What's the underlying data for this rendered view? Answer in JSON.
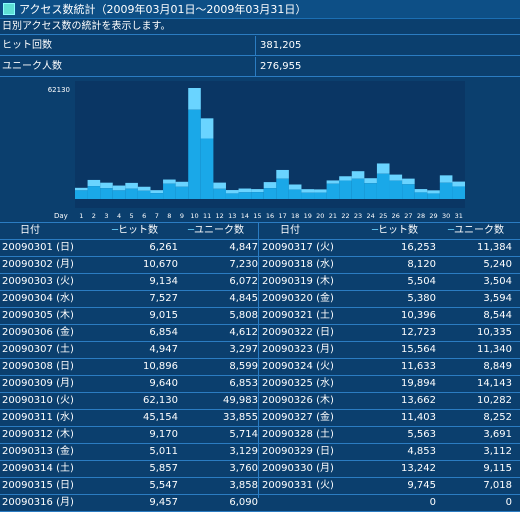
{
  "title": "アクセス数統計（2009年03月01日～2009年03月31日）",
  "description": "日別アクセス数の統計を表示します。",
  "stats": [
    {
      "label": "ヒット回数",
      "value": "381,205"
    },
    {
      "label": "ユニーク人数",
      "value": "276,955"
    }
  ],
  "colors": {
    "hit": "#1aa8e8",
    "unique": "#0a7fd0",
    "hit_light": "#6ad4ff",
    "plot_bg": "#0a3664"
  },
  "chart_data": {
    "type": "bar",
    "ymax_label": "62130",
    "xlabel": "Day",
    "categories": [
      "1",
      "2",
      "3",
      "4",
      "5",
      "6",
      "7",
      "8",
      "9",
      "10",
      "11",
      "12",
      "13",
      "14",
      "15",
      "16",
      "17",
      "18",
      "19",
      "20",
      "21",
      "22",
      "23",
      "24",
      "25",
      "26",
      "27",
      "28",
      "29",
      "30",
      "31"
    ],
    "series": [
      {
        "name": "ヒット数",
        "values": [
          6261,
          10670,
          9134,
          7527,
          9015,
          6854,
          4947,
          10896,
          9640,
          62130,
          45154,
          9170,
          5011,
          5857,
          5547,
          9457,
          16253,
          8120,
          5504,
          5380,
          10396,
          12723,
          15564,
          11633,
          19894,
          13662,
          11403,
          5563,
          4853,
          13242,
          9745
        ]
      },
      {
        "name": "ユニーク数",
        "values": [
          4847,
          7230,
          6072,
          4845,
          5808,
          4612,
          3297,
          8599,
          6853,
          49983,
          33855,
          5714,
          3129,
          3760,
          3858,
          6090,
          11384,
          5240,
          3504,
          3594,
          8544,
          10335,
          11340,
          8849,
          14143,
          10282,
          8252,
          3691,
          3112,
          9115,
          7018
        ]
      }
    ]
  },
  "table_headers": {
    "date": "日付",
    "hits": "ヒット数",
    "unique": "ユニーク数"
  },
  "left_rows": [
    {
      "date": "20090301 (日)",
      "hits": "6,261",
      "unique": "4,847"
    },
    {
      "date": "20090302 (月)",
      "hits": "10,670",
      "unique": "7,230"
    },
    {
      "date": "20090303 (火)",
      "hits": "9,134",
      "unique": "6,072"
    },
    {
      "date": "20090304 (水)",
      "hits": "7,527",
      "unique": "4,845"
    },
    {
      "date": "20090305 (木)",
      "hits": "9,015",
      "unique": "5,808"
    },
    {
      "date": "20090306 (金)",
      "hits": "6,854",
      "unique": "4,612"
    },
    {
      "date": "20090307 (土)",
      "hits": "4,947",
      "unique": "3,297"
    },
    {
      "date": "20090308 (日)",
      "hits": "10,896",
      "unique": "8,599"
    },
    {
      "date": "20090309 (月)",
      "hits": "9,640",
      "unique": "6,853"
    },
    {
      "date": "20090310 (火)",
      "hits": "62,130",
      "unique": "49,983"
    },
    {
      "date": "20090311 (水)",
      "hits": "45,154",
      "unique": "33,855"
    },
    {
      "date": "20090312 (木)",
      "hits": "9,170",
      "unique": "5,714"
    },
    {
      "date": "20090313 (金)",
      "hits": "5,011",
      "unique": "3,129"
    },
    {
      "date": "20090314 (土)",
      "hits": "5,857",
      "unique": "3,760"
    },
    {
      "date": "20090315 (日)",
      "hits": "5,547",
      "unique": "3,858"
    },
    {
      "date": "20090316 (月)",
      "hits": "9,457",
      "unique": "6,090"
    }
  ],
  "right_rows": [
    {
      "date": "20090317 (火)",
      "hits": "16,253",
      "unique": "11,384"
    },
    {
      "date": "20090318 (水)",
      "hits": "8,120",
      "unique": "5,240"
    },
    {
      "date": "20090319 (木)",
      "hits": "5,504",
      "unique": "3,504"
    },
    {
      "date": "20090320 (金)",
      "hits": "5,380",
      "unique": "3,594"
    },
    {
      "date": "20090321 (土)",
      "hits": "10,396",
      "unique": "8,544"
    },
    {
      "date": "20090322 (日)",
      "hits": "12,723",
      "unique": "10,335"
    },
    {
      "date": "20090323 (月)",
      "hits": "15,564",
      "unique": "11,340"
    },
    {
      "date": "20090324 (火)",
      "hits": "11,633",
      "unique": "8,849"
    },
    {
      "date": "20090325 (水)",
      "hits": "19,894",
      "unique": "14,143"
    },
    {
      "date": "20090326 (木)",
      "hits": "13,662",
      "unique": "10,282"
    },
    {
      "date": "20090327 (金)",
      "hits": "11,403",
      "unique": "8,252"
    },
    {
      "date": "20090328 (土)",
      "hits": "5,563",
      "unique": "3,691"
    },
    {
      "date": "20090329 (日)",
      "hits": "4,853",
      "unique": "3,112"
    },
    {
      "date": "20090330 (月)",
      "hits": "13,242",
      "unique": "9,115"
    },
    {
      "date": "20090331 (火)",
      "hits": "9,745",
      "unique": "7,018"
    },
    {
      "date": "",
      "hits": "0",
      "unique": "0"
    }
  ]
}
